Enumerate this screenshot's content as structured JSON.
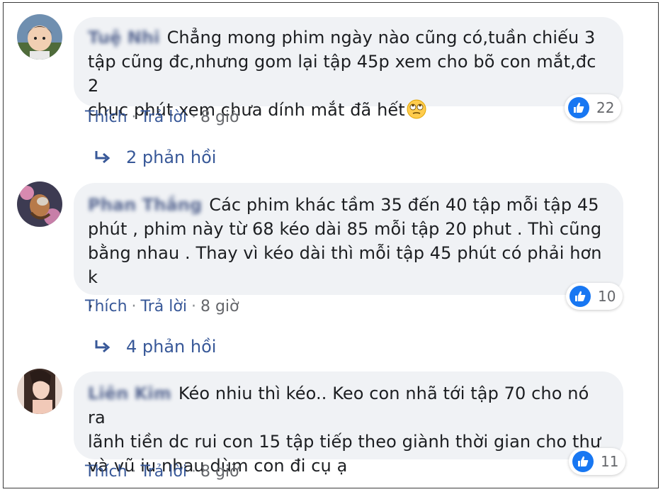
{
  "colors": {
    "bubble_bg": "#f0f2f5",
    "link": "#385898",
    "like_blue": "#1877f2",
    "meta_gray": "#65676b"
  },
  "comments": [
    {
      "author": "Tuệ Nhi",
      "text": "Chẳng mong phim ngày nào cũng có,tuần chiếu 3\ntập cũng đc,nhưng gom lại tập 45p xem cho bõ con mắt,đc 2\nchục phút xem chưa dính mắt đã hết",
      "emoji": "face-with-rolling-eyes",
      "actions": {
        "like": "Thích",
        "reply": "Trả lời",
        "time": "8 giờ"
      },
      "reaction_count": "22",
      "replies_label": "2 phản hồi"
    },
    {
      "author": "Phan Thắng",
      "text": "Các phim khác tầm 35 đến 40 tập mỗi tập 45\nphút , phim này từ 68 kéo dài 85 mỗi tập 20 phut . Thì cũng\nbằng nhau . Thay vì kéo dài thì mỗi tập 45 phút có phải hơn k\n,",
      "actions": {
        "like": "Thích",
        "reply": "Trả lời",
        "time": "8 giờ"
      },
      "reaction_count": "10",
      "replies_label": "4 phản hồi"
    },
    {
      "author": "Liên Kim",
      "text": "Kéo nhiu thì kéo.. Keo con nhã tới tập 70 cho nó ra\nlãnh tiền dc rui con 15 tập tiếp theo giành thời gian cho thư\nvà vũ iu nhau dùm con đi cụ ạ",
      "actions": {
        "like": "Thích",
        "reply": "Trả lời",
        "time": "8 giờ"
      },
      "reaction_count": "11"
    }
  ]
}
